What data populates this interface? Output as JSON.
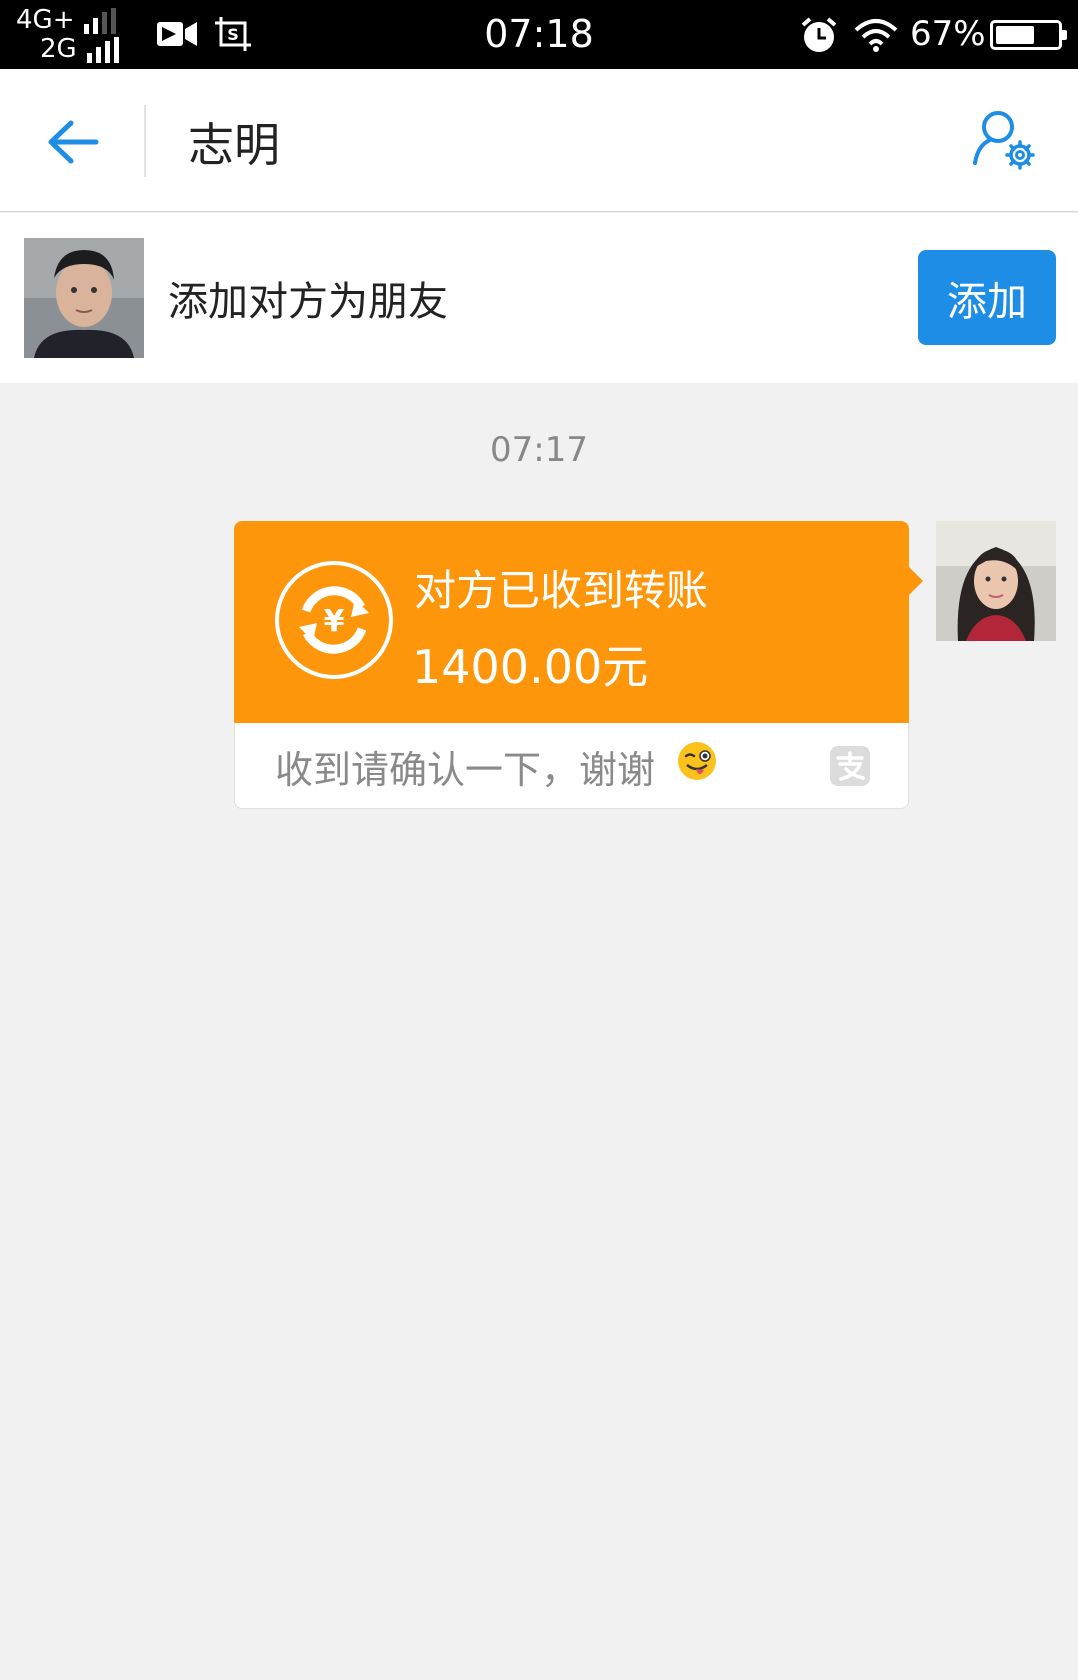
{
  "status_bar": {
    "network_top": "4G+",
    "network_bottom": "2G",
    "time": "07:18",
    "battery_percent": "67%",
    "battery_level": 0.67,
    "icons": [
      "video-icon",
      "screenshot-icon",
      "alarm-icon",
      "wifi-icon",
      "battery-icon"
    ]
  },
  "header": {
    "title": "志明",
    "back_icon": "arrow-left-icon",
    "settings_icon": "contact-settings-icon"
  },
  "friend_bar": {
    "text": "添加对方为朋友",
    "add_button": "添加"
  },
  "chat": {
    "timestamp": "07:17",
    "transfer_card": {
      "title": "对方已收到转账",
      "amount": "1400.00元",
      "note": "收到请确认一下，谢谢",
      "note_emoji": "winking-tongue-emoji",
      "icon": "yuan-transfer-icon",
      "brand_icon": "alipay-icon"
    }
  },
  "colors": {
    "accent_blue": "#1d8de6",
    "transfer_orange": "#fe960b",
    "background": "#f1f1f1"
  }
}
